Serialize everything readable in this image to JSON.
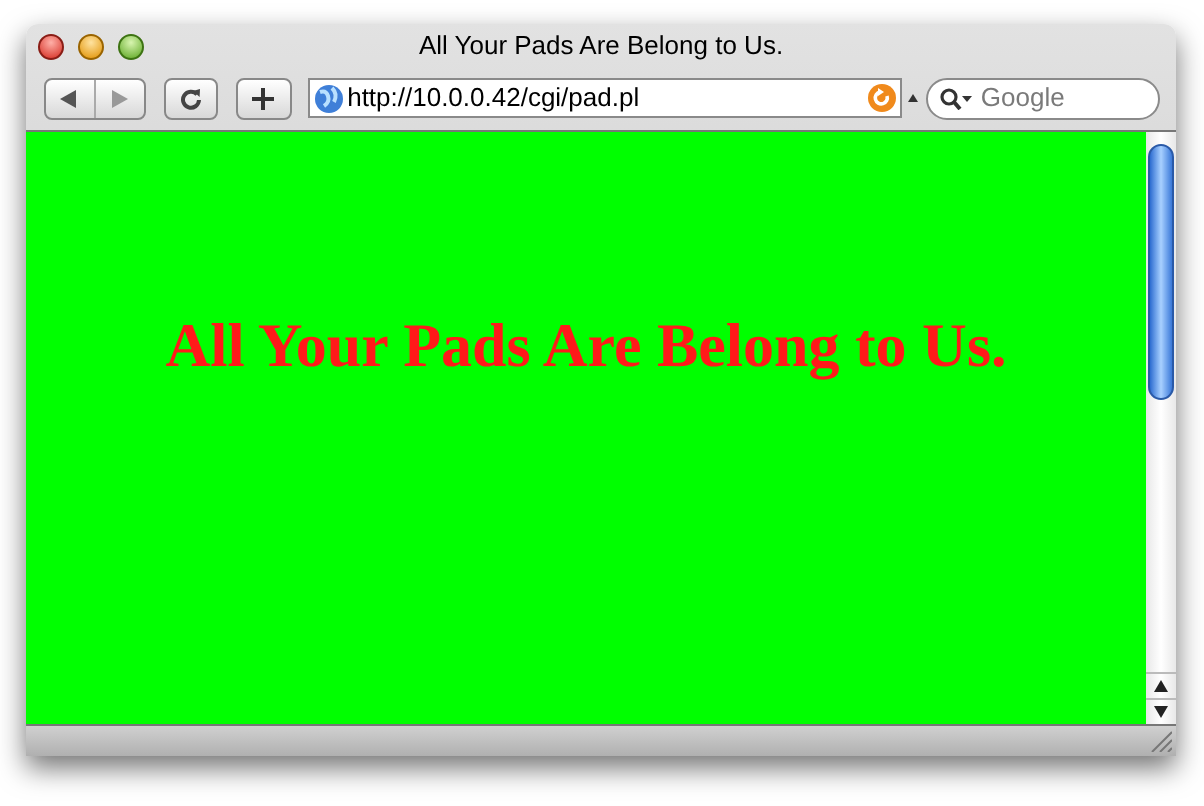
{
  "window": {
    "title": "All Your Pads Are Belong to Us."
  },
  "toolbar": {
    "address": "http://10.0.0.42/cgi/pad.pl",
    "search": {
      "placeholder": "Google"
    }
  },
  "page": {
    "heading": "All Your Pads Are Belong to Us."
  }
}
